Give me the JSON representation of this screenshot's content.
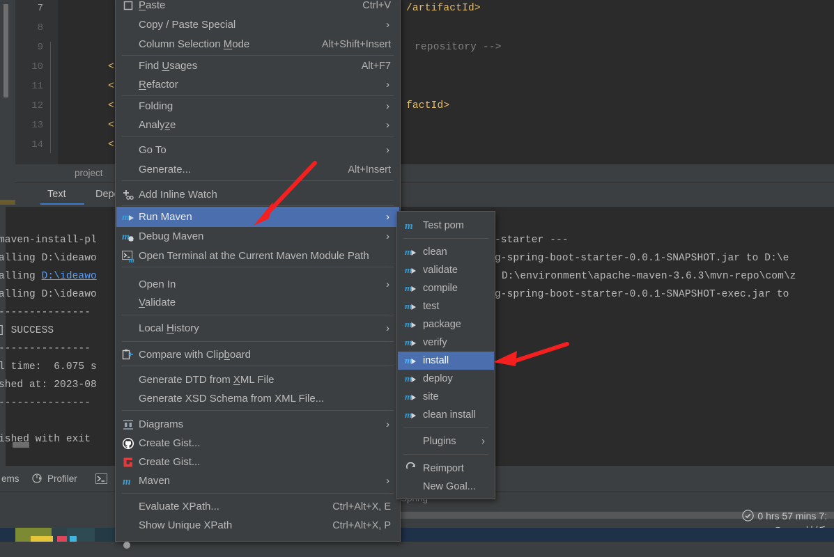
{
  "editor": {
    "line_numbers": [
      "7",
      "8",
      "9",
      "10",
      "11",
      "12",
      "13",
      "14"
    ],
    "code_lines": [
      {
        "text": "/artifactId>",
        "kind": "tag"
      },
      {
        "text": "",
        "kind": "plain"
      },
      {
        "text": "repository -->",
        "kind": "comment"
      },
      {
        "text": "<",
        "kind": "tag"
      },
      {
        "text": "<",
        "kind": "tag"
      },
      {
        "text": "<",
        "kind": "tag"
      },
      {
        "text": "factId>",
        "kind": "tag"
      },
      {
        "text": "<",
        "kind": "tag"
      }
    ],
    "breadcrumb": "project",
    "tabs": [
      {
        "label": "Text",
        "active": true
      },
      {
        "label": "Depe",
        "active": false
      }
    ]
  },
  "console": {
    "lines": [
      "maven-install-pl",
      "alling D:\\ideawo",
      "alling D:\\ideawo",
      "alling D:\\ideawo",
      "---------------",
      "] SUCCESS",
      "---------------",
      "l time:  6.075 s",
      "shed at: 2023-08",
      "---------------",
      "",
      "ished with exit"
    ],
    "right_lines": [
      "-starter ---",
      "g-spring-boot-starter-0.0.1-SNAPSHOT.jar to D:\\e",
      "D:\\environment\\apache-maven-3.6.3\\mvn-repo\\com\\z",
      "g-spring-boot-starter-0.0.1-SNAPSHOT-exec.jar to"
    ],
    "link_line": "D:\\ideawo",
    "toolbar": [
      {
        "label": "ems",
        "icon": "problems-icon"
      },
      {
        "label": "Profiler",
        "icon": "profiler-icon"
      },
      {
        "label": "",
        "icon": "terminal-icon"
      }
    ]
  },
  "status": {
    "spring_label": "Spring",
    "timer": "0 hrs 57 mins   7:",
    "timer_icon": "clock-check-icon",
    "watermark": "CSDN @Java炒饭"
  },
  "context_menu": {
    "items": [
      {
        "label": "Paste",
        "mnemonic": "P",
        "accel": "Ctrl+V",
        "icon": "paste-icon",
        "submenu": false,
        "separator_after": false
      },
      {
        "label": "Copy / Paste Special",
        "mnemonic": "",
        "accel": "",
        "icon": "",
        "submenu": true,
        "separator_after": false
      },
      {
        "label": "Column Selection Mode",
        "mnemonic": "M",
        "accel": "Alt+Shift+Insert",
        "icon": "",
        "submenu": false,
        "separator_after": true
      },
      {
        "label": "Find Usages",
        "mnemonic": "U",
        "accel": "Alt+F7",
        "icon": "",
        "submenu": false,
        "separator_after": false
      },
      {
        "label": "Refactor",
        "mnemonic": "R",
        "accel": "",
        "icon": "",
        "submenu": true,
        "separator_after": true
      },
      {
        "label": "Folding",
        "mnemonic": "",
        "accel": "",
        "icon": "",
        "submenu": true,
        "separator_after": false
      },
      {
        "label": "Analyze",
        "mnemonic": "z",
        "accel": "",
        "icon": "",
        "submenu": true,
        "separator_after": true
      },
      {
        "label": "Go To",
        "mnemonic": "",
        "accel": "",
        "icon": "",
        "submenu": true,
        "separator_after": false
      },
      {
        "label": "Generate...",
        "mnemonic": "",
        "accel": "Alt+Insert",
        "icon": "",
        "submenu": false,
        "separator_after": true
      },
      {
        "label": "Add Inline Watch",
        "mnemonic": "",
        "accel": "",
        "icon": "add-watch-icon",
        "submenu": false,
        "separator_after": true
      },
      {
        "label": "Run Maven",
        "mnemonic": "",
        "accel": "",
        "icon": "maven-run-icon",
        "submenu": true,
        "separator_after": false,
        "selected": true
      },
      {
        "label": "Debug Maven",
        "mnemonic": "",
        "accel": "",
        "icon": "maven-debug-icon",
        "submenu": true,
        "separator_after": false
      },
      {
        "label": "Open Terminal at the Current Maven Module Path",
        "mnemonic": "",
        "accel": "",
        "icon": "terminal-maven-icon",
        "submenu": false,
        "separator_after": true
      },
      {
        "label": "Open In",
        "mnemonic": "",
        "accel": "",
        "icon": "",
        "submenu": true,
        "separator_after": false
      },
      {
        "label": "Validate",
        "mnemonic": "V",
        "accel": "",
        "icon": "",
        "submenu": false,
        "separator_after": true
      },
      {
        "label": "Local History",
        "mnemonic": "H",
        "accel": "",
        "icon": "",
        "submenu": true,
        "separator_after": true
      },
      {
        "label": "Compare with Clipboard",
        "mnemonic": "b",
        "accel": "",
        "icon": "compare-clipboard-icon",
        "submenu": false,
        "separator_after": true
      },
      {
        "label": "Generate DTD from XML File",
        "mnemonic": "X",
        "accel": "",
        "icon": "",
        "submenu": false,
        "separator_after": false
      },
      {
        "label": "Generate XSD Schema from XML File...",
        "mnemonic": "",
        "accel": "",
        "icon": "",
        "submenu": false,
        "separator_after": true
      },
      {
        "label": "Diagrams",
        "mnemonic": "",
        "accel": "",
        "icon": "diagram-icon",
        "submenu": true,
        "separator_after": false
      },
      {
        "label": "Create Gist...",
        "mnemonic": "",
        "accel": "",
        "icon": "github-icon",
        "submenu": false,
        "separator_after": false
      },
      {
        "label": "Create Gist...",
        "mnemonic": "",
        "accel": "",
        "icon": "gitlab-icon",
        "submenu": false,
        "separator_after": false
      },
      {
        "label": "Maven",
        "mnemonic": "",
        "accel": "",
        "icon": "maven-icon",
        "submenu": true,
        "separator_after": true
      },
      {
        "label": "Evaluate XPath...",
        "mnemonic": "",
        "accel": "Ctrl+Alt+X, E",
        "icon": "",
        "submenu": false,
        "separator_after": false
      },
      {
        "label": "Show Unique XPath",
        "mnemonic": "",
        "accel": "Ctrl+Alt+X, P",
        "icon": "",
        "submenu": false,
        "separator_after": false
      }
    ]
  },
  "submenu": {
    "items": [
      {
        "label": "Test pom",
        "icon": "maven-icon",
        "submenu": false,
        "separator_after": true
      },
      {
        "label": "clean",
        "icon": "maven-goal-icon",
        "submenu": false,
        "separator_after": false
      },
      {
        "label": "validate",
        "icon": "maven-goal-icon",
        "submenu": false,
        "separator_after": false
      },
      {
        "label": "compile",
        "icon": "maven-goal-icon",
        "submenu": false,
        "separator_after": false
      },
      {
        "label": "test",
        "icon": "maven-goal-icon",
        "submenu": false,
        "separator_after": false
      },
      {
        "label": "package",
        "icon": "maven-goal-icon",
        "submenu": false,
        "separator_after": false
      },
      {
        "label": "verify",
        "icon": "maven-goal-icon",
        "submenu": false,
        "separator_after": false
      },
      {
        "label": "install",
        "icon": "maven-goal-icon",
        "submenu": false,
        "separator_after": false,
        "selected": true
      },
      {
        "label": "deploy",
        "icon": "maven-goal-icon",
        "submenu": false,
        "separator_after": false
      },
      {
        "label": "site",
        "icon": "maven-goal-icon",
        "submenu": false,
        "separator_after": false
      },
      {
        "label": "clean install",
        "icon": "maven-goal-icon",
        "submenu": false,
        "separator_after": true
      },
      {
        "label": "Plugins",
        "icon": "",
        "submenu": true,
        "separator_after": true
      },
      {
        "label": "Reimport",
        "icon": "refresh-icon",
        "submenu": false,
        "separator_after": false
      },
      {
        "label": "New Goal...",
        "icon": "",
        "submenu": false,
        "separator_after": false
      }
    ]
  },
  "annotations": {
    "arrow_color": "#f42020",
    "arrow1_target": "Run Maven",
    "arrow2_target": "install"
  }
}
